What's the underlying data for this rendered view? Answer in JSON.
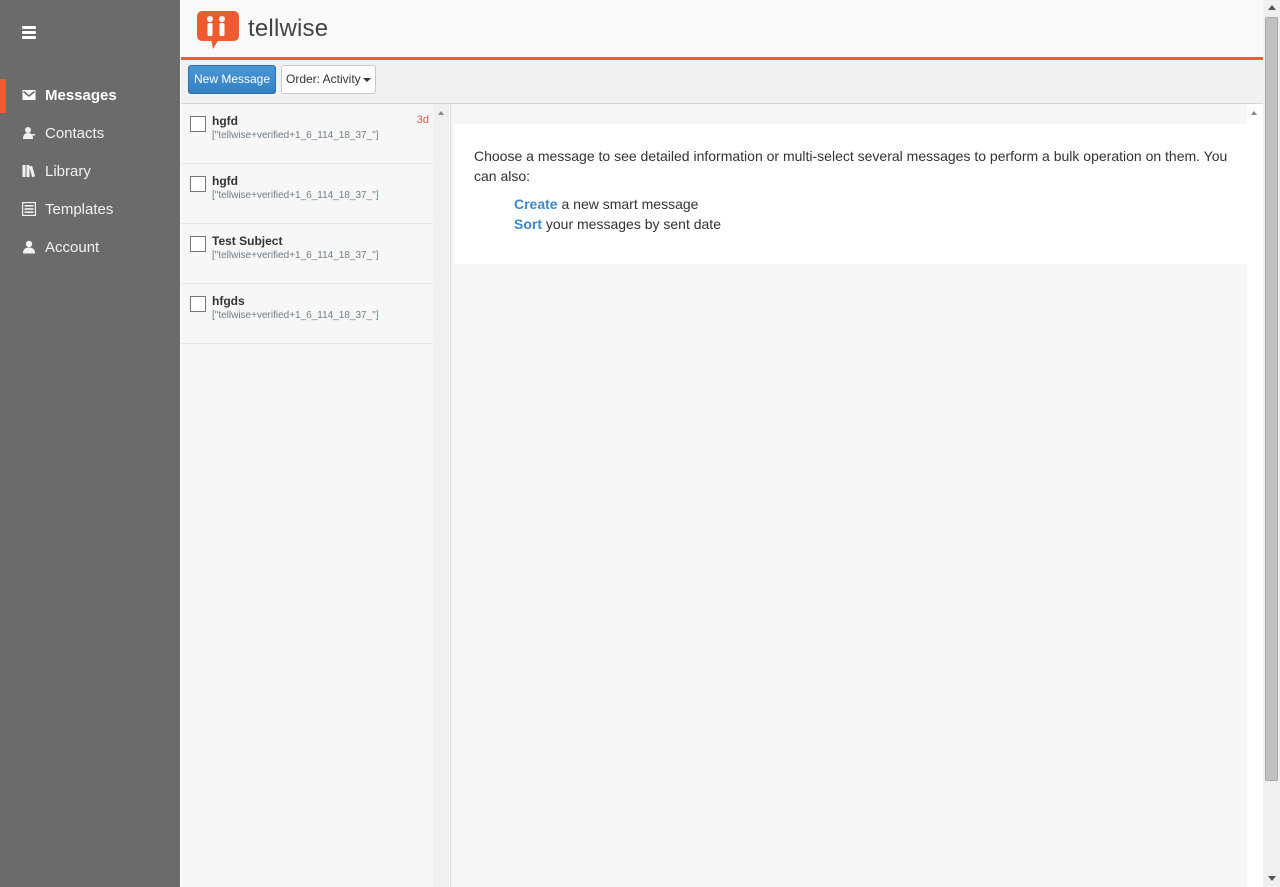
{
  "app": {
    "brand": "tellwise",
    "accent_color": "#ef5b30"
  },
  "sidebar": {
    "menu_icon": "hamburger-icon",
    "items": [
      {
        "label": "Messages",
        "icon": "envelope-icon",
        "active": true
      },
      {
        "label": "Contacts",
        "icon": "person-icon",
        "active": false
      },
      {
        "label": "Library",
        "icon": "books-icon",
        "active": false
      },
      {
        "label": "Templates",
        "icon": "template-icon",
        "active": false
      },
      {
        "label": "Account",
        "icon": "user-icon",
        "active": false
      }
    ]
  },
  "toolbar": {
    "new_message_label": "New Message",
    "order_label": "Order: Activity"
  },
  "messages": [
    {
      "subject": "hgfd",
      "recipients": "[\"tellwise+verified+1_6_114_18_37_\"]",
      "age": "3d"
    },
    {
      "subject": "hgfd",
      "recipients": "[\"tellwise+verified+1_6_114_18_37_\"]",
      "age": ""
    },
    {
      "subject": "Test Subject",
      "recipients": "[\"tellwise+verified+1_6_114_18_37_\"]",
      "age": ""
    },
    {
      "subject": "hfgds",
      "recipients": "[\"tellwise+verified+1_6_114_18_37_\"]",
      "age": ""
    }
  ],
  "detail": {
    "intro": "Choose a message to see detailed information or multi-select several messages to perform a bulk operation on them. You can also:",
    "options": [
      {
        "link": "Create",
        "text": " a new smart message"
      },
      {
        "link": "Sort",
        "text": " your messages by sent date"
      }
    ]
  }
}
